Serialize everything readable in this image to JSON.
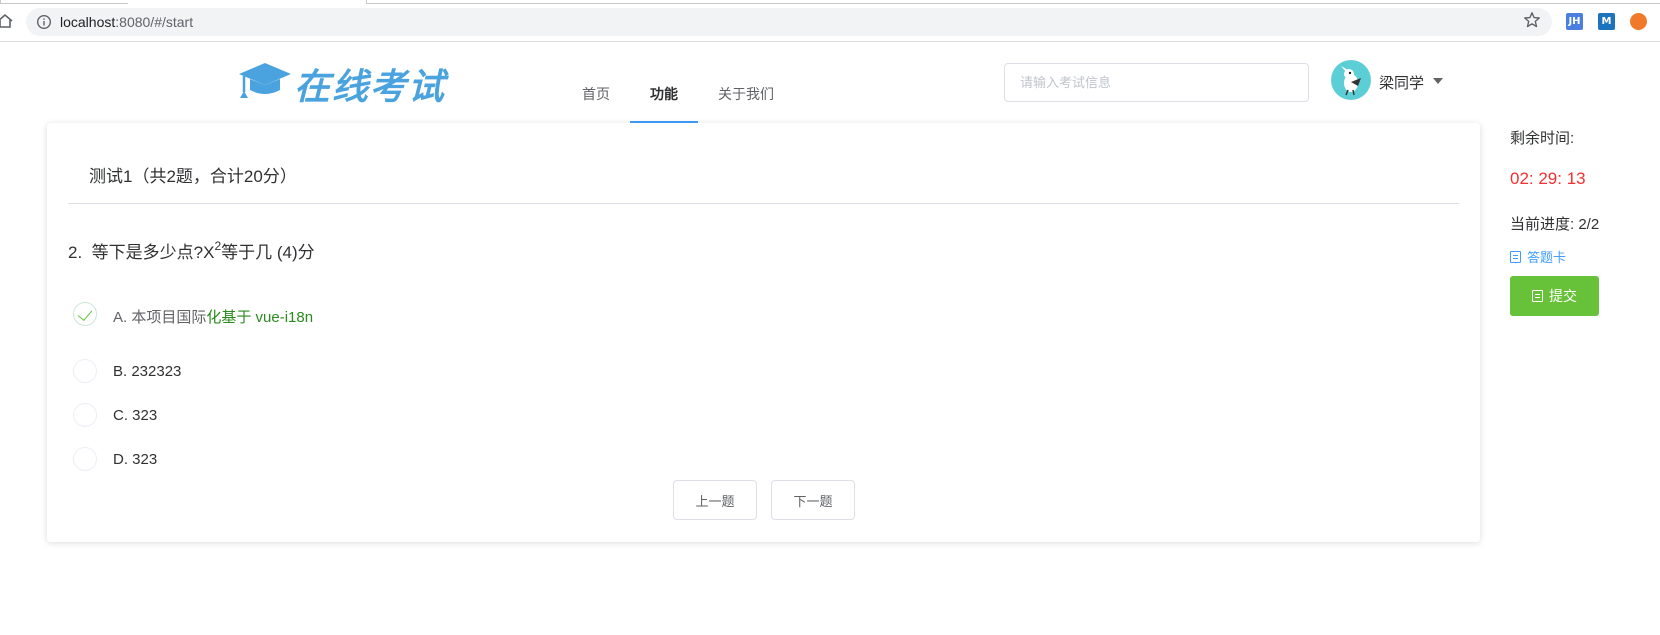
{
  "browser": {
    "url_host": "localhost",
    "url_rest": ":8080/#/start",
    "extensions": [
      {
        "name": "jh-extension-icon",
        "label": "JH",
        "color": "#4a7fe0"
      },
      {
        "name": "m-extension-icon",
        "label": "M",
        "color": "#1e73be"
      },
      {
        "name": "orange-extension-icon",
        "label": "",
        "color": "#f07a2a"
      }
    ]
  },
  "header": {
    "logo_text": "在线考试",
    "nav": [
      "首页",
      "功能",
      "关于我们"
    ],
    "active_nav": "功能",
    "search_placeholder": "请输入考试信息",
    "user_name": "梁同学"
  },
  "exam": {
    "title": "测试1（共2题，合计20分）",
    "question_number": "2.",
    "question_text_before": "等下是多少点?X",
    "question_sup": "2",
    "question_text_after": "等于几 (4)分",
    "options": [
      {
        "lead": "A. 本项目国际",
        "rest": "化基于 vue-i18n",
        "selected": true
      },
      {
        "lead": "B. 232323",
        "rest": "",
        "selected": false
      },
      {
        "lead": "C. 323",
        "rest": "",
        "selected": false
      },
      {
        "lead": "D. 323",
        "rest": "",
        "selected": false
      }
    ],
    "prev_label": "上一题",
    "next_label": "下一题"
  },
  "sidebar": {
    "time_label": "剩余时间:",
    "time_value": "02: 29: 13",
    "progress_label": "当前进度: 2/2",
    "answer_card_label": "答题卡",
    "submit_label": "提交"
  },
  "colors": {
    "accent": "#409eff",
    "timer": "#f23030",
    "submit": "#67c23a",
    "logo": "#4aa3df"
  }
}
